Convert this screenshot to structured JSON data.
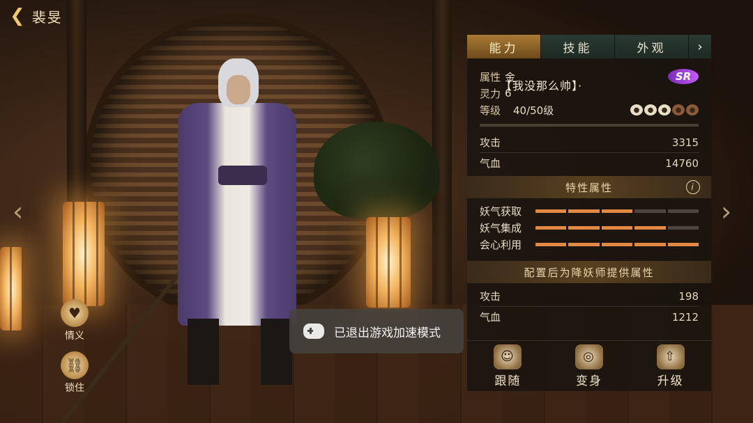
{
  "header": {
    "back_icon": "back-arrow-icon",
    "title": "裴旻"
  },
  "tabs": [
    {
      "label": "能力",
      "active": true
    },
    {
      "label": "技能",
      "active": false
    },
    {
      "label": "外观",
      "active": false
    }
  ],
  "tab_next_icon": "chevron-right-icon",
  "name_tag": "【我没那么帅】·",
  "stats": {
    "attr_label": "属性",
    "attr_value": "金",
    "rarity": "SR",
    "spirit_label": "灵力",
    "spirit_value": "6",
    "level_label": "等级",
    "level_value": "40/50级",
    "stars": {
      "filled": 3,
      "total": 5
    },
    "attack_label": "攻击",
    "attack_value": "3315",
    "hp_label": "气血",
    "hp_value": "14760"
  },
  "traits_section": {
    "title": "特性属性",
    "info_icon": "info-icon"
  },
  "traits": [
    {
      "label": "妖气获取",
      "level": 3,
      "max": 5
    },
    {
      "label": "妖气集成",
      "level": 4,
      "max": 5
    },
    {
      "label": "会心利用",
      "level": 5,
      "max": 5
    }
  ],
  "bonus_section": {
    "title": "配置后为降妖师提供属性"
  },
  "bonus": {
    "attack_label": "攻击",
    "attack_value": "198",
    "hp_label": "气血",
    "hp_value": "1212"
  },
  "actions": [
    {
      "label": "跟随",
      "icon": "follow-icon"
    },
    {
      "label": "变身",
      "icon": "transform-icon"
    },
    {
      "label": "升级",
      "icon": "upgrade-icon"
    }
  ],
  "left_buttons": [
    {
      "label": "情义",
      "icon": "friendship-icon"
    },
    {
      "label": "锁住",
      "icon": "lock-icon"
    }
  ],
  "toast": {
    "icon": "gamepad-icon",
    "text": "已退出游戏加速模式"
  },
  "colors": {
    "accent": "#a97a36",
    "rarity": "#9b3fe0",
    "trait_bar": "#e28a45"
  }
}
